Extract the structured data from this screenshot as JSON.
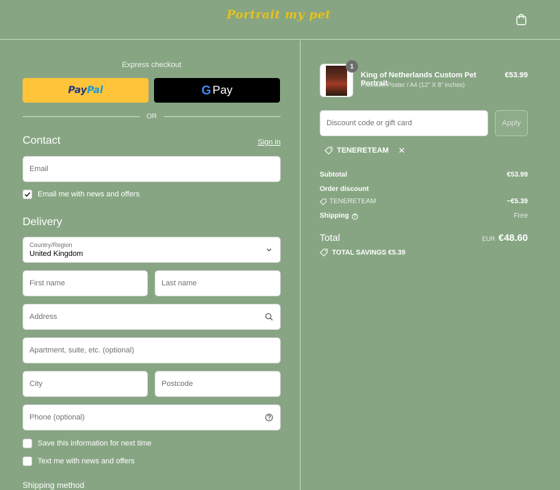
{
  "header": {
    "logo_text": "Portrait my pet",
    "cart_icon": "shopping-bag-icon"
  },
  "express": {
    "label": "Express checkout",
    "paypal_part1": "Pay",
    "paypal_part2": "Pal",
    "gpay_g": "G",
    "gpay_text": "Pay",
    "or_text": "OR"
  },
  "contact": {
    "title": "Contact",
    "signin_label": "Sign in",
    "email_placeholder": "Email",
    "newsletter_label": "Email me with news and offers",
    "newsletter_checked": true
  },
  "delivery": {
    "title": "Delivery",
    "country_label": "Country/Region",
    "country_value": "United Kingdom",
    "first_name_placeholder": "First name",
    "last_name_placeholder": "Last name",
    "address_placeholder": "Address",
    "apartment_placeholder": "Apartment, suite, etc. (optional)",
    "city_placeholder": "City",
    "postcode_placeholder": "Postcode",
    "phone_placeholder": "Phone (optional)",
    "save_info_label": "Save this information for next time",
    "text_me_label": "Text me with news and offers"
  },
  "shipping_method": {
    "title": "Shipping method"
  },
  "order": {
    "product": {
      "name": "King of Netherlands Custom Pet Portrait",
      "variant": "Premium Poster / A4 (12\" X 8\" inches)",
      "price": "€53.99",
      "quantity": "1"
    },
    "discount_placeholder": "Discount code or gift card",
    "apply_label": "Apply",
    "applied_code": "TENERETEAM",
    "subtotal_label": "Subtotal",
    "subtotal_value": "€53.99",
    "order_discount_label": "Order discount",
    "discount_code": "TENERETEAM",
    "discount_value": "−€5.39",
    "shipping_label": "Shipping",
    "shipping_value": "Free",
    "total_label": "Total",
    "total_currency": "EUR",
    "total_value": "€48.60",
    "savings_text": "TOTAL SAVINGS €5.39"
  },
  "colors": {
    "background": "#87a583",
    "paypal_yellow": "#ffc439",
    "logo_gold": "#e8c21b"
  }
}
